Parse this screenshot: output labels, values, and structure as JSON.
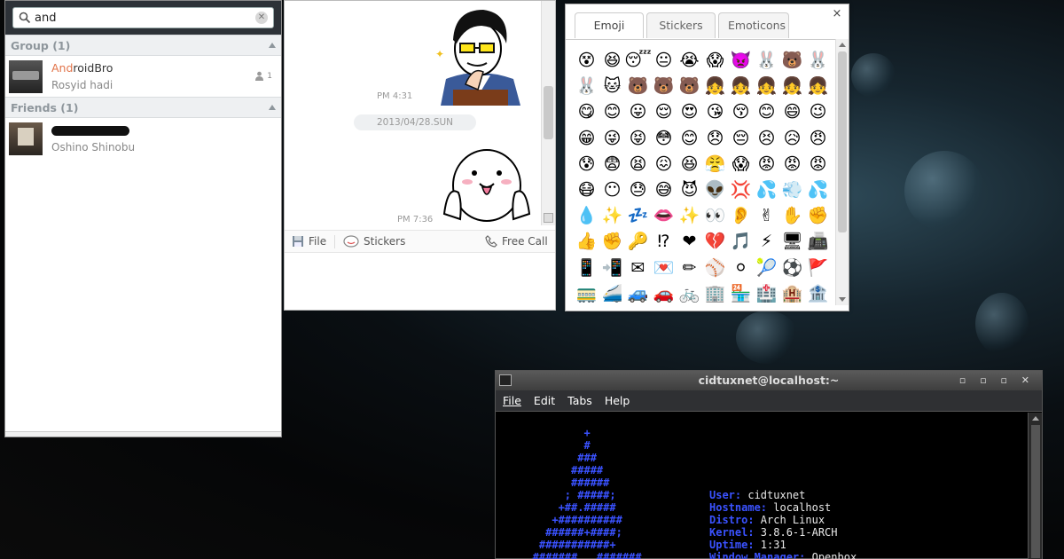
{
  "contacts": {
    "search": {
      "value": "and"
    },
    "group_section": {
      "title": "Group (1)"
    },
    "group_item": {
      "name_highlight": "And",
      "name_rest": "roidBro",
      "subtitle": "Rosyid hadi",
      "member_count": "1"
    },
    "friends_section": {
      "title": "Friends (1)"
    },
    "friend_item": {
      "subtitle": "Oshino Shinobu"
    }
  },
  "chat": {
    "time1": "PM 4:31",
    "date_divider": "2013/04/28.SUN",
    "time2": "PM 7:36",
    "toolbar": {
      "file_label": "File",
      "stickers_label": "Stickers",
      "free_call_label": "Free Call"
    }
  },
  "emoji_picker": {
    "tabs": [
      {
        "label": "Emoji"
      },
      {
        "label": "Stickers"
      },
      {
        "label": "Emoticons"
      }
    ],
    "active_tab": "Emoji",
    "close_label": "×",
    "emojis": [
      "😵",
      "😆",
      "😴",
      "😐",
      "😭",
      "😱",
      "👿",
      "🐰",
      "🐻",
      "🐰",
      "🐰",
      "🐱",
      "🐻",
      "🐻",
      "🐻",
      "👧",
      "👧",
      "👧",
      "👧",
      "👧",
      "😋",
      "😊",
      "😛",
      "😌",
      "😍",
      "😘",
      "😚",
      "😊",
      "😄",
      "😉",
      "😁",
      "😜",
      "😝",
      "😳",
      "😊",
      "😞",
      "😔",
      "😣",
      "😥",
      "😠",
      "😰",
      "😨",
      "😫",
      "😖",
      "😆",
      "😤",
      "😱",
      "😡",
      "😡",
      "😡",
      "😷",
      "😶",
      "😓",
      "😅",
      "😈",
      "👽",
      "💢",
      "💦",
      "💨",
      "💦",
      "💧",
      "✨",
      "💤",
      "👄",
      "✨",
      "👀",
      "👂",
      "✌",
      "✋",
      "✊",
      "👍",
      "✊",
      "🔑",
      "⁉",
      "❤",
      "💔",
      "🎵",
      "⚡",
      "🖥",
      "📠",
      "📱",
      "📲",
      "✉",
      "💌",
      "✏",
      "⚾",
      "⚪",
      "🎾",
      "⚽",
      "🚩",
      "🚃",
      "🚄",
      "🚙",
      "🚗",
      "🚲",
      "🏢",
      "🏪",
      "🏥",
      "🏨",
      "🏦"
    ]
  },
  "terminal": {
    "title": "cidtuxnet@localhost:~",
    "menu": {
      "file": "File",
      "edit": "Edit",
      "tabs": "Tabs",
      "help": "Help"
    },
    "logo_lines": [
      "           +",
      "           #",
      "          ###",
      "         #####",
      "         ######",
      "        ; #####;",
      "       +##.#####",
      "      +##########",
      "     ######+####;",
      "    ###########+",
      "   #######   #######"
    ],
    "info": {
      "user_key": "User:",
      "user_val": " cidtuxnet",
      "hostname_key": "Hostname:",
      "hostname_val": " localhost",
      "distro_key": "Distro:",
      "distro_val": " Arch Linux",
      "kernel_key": "Kernel:",
      "kernel_val": " 3.8.6-1-ARCH",
      "uptime_key": "Uptime:",
      "uptime_val": " 1:31",
      "wm_key": "Window Manager:",
      "wm_val": " Openbox"
    }
  }
}
